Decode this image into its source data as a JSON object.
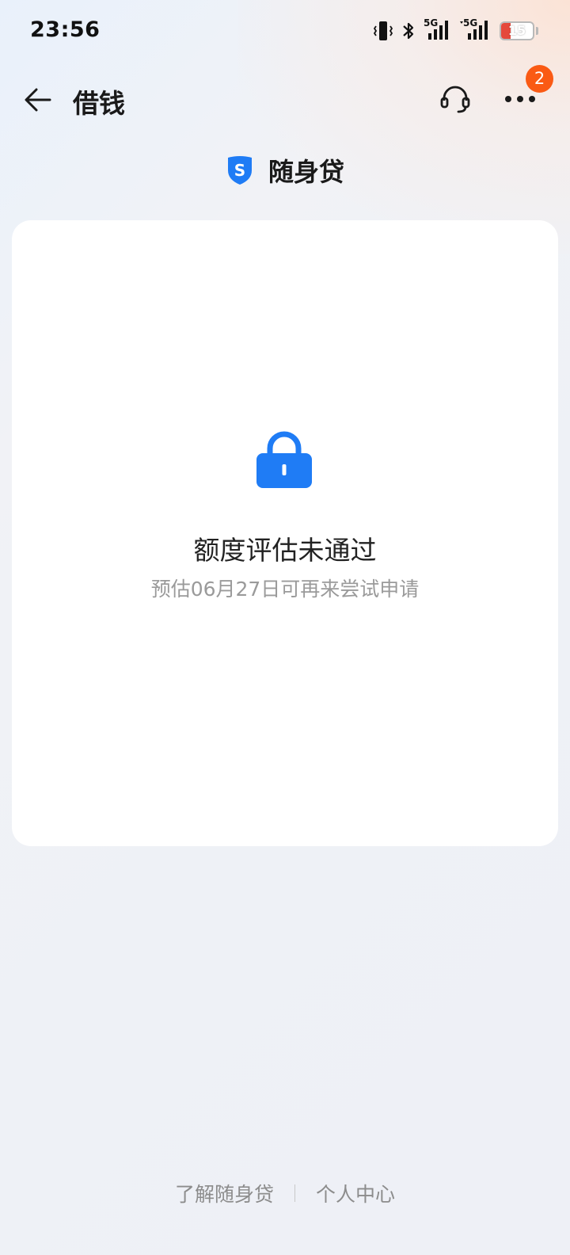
{
  "status_bar": {
    "time": "23:56",
    "network_1": "5G",
    "network_2": "5G",
    "battery": "15",
    "battery_color": "#e5483b"
  },
  "header": {
    "title": "借钱",
    "back_icon": "arrow-left-icon",
    "service_icon": "headset-icon",
    "more_icon": "more-dots-icon",
    "badge_count": "2",
    "badge_color": "#fa5a14"
  },
  "product": {
    "name": "随身贷",
    "logo_icon": "shield-s-icon",
    "logo_letter": "S",
    "brand_color": "#1f7cf5"
  },
  "result": {
    "icon": "lock-icon",
    "title": "额度评估未通过",
    "subtitle": "预估06月27日可再来尝试申请"
  },
  "footer": {
    "link_about": "了解随身贷",
    "link_personal": "个人中心"
  }
}
